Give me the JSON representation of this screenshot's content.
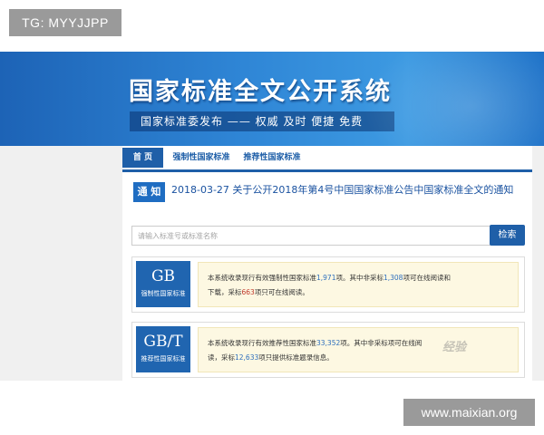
{
  "watermark": {
    "tag": "TG: MYYJJPP",
    "site": "www.maixian.org",
    "jingyan": "经验"
  },
  "banner": {
    "title": "国家标准全文公开系统",
    "slogan": "国家标准委发布 —— 权威 及时 便捷 免费"
  },
  "nav": {
    "tabs": [
      {
        "label": "首 页"
      },
      {
        "label": "强制性国家标准"
      },
      {
        "label": "推荐性国家标准"
      }
    ]
  },
  "notice": {
    "badge": "通 知",
    "text": "2018-03-27  关于公开2018年第4号中国国家标准公告中国家标准全文的通知"
  },
  "search": {
    "placeholder": "请输入标准号或标准名称",
    "button": "检索"
  },
  "standards": [
    {
      "code": "GB",
      "subtitle": "强制性国家标准",
      "line1_prefix": "本系统收录现行有效强制性国家标准",
      "total": "1,971",
      "line1_mid": "项。其中非采标",
      "non_adopted": "1,308",
      "line1_suffix": "项可在线阅读和",
      "line2_prefix": "下载，采标",
      "adopted": "663",
      "line2_suffix": "项只可在线阅读。"
    },
    {
      "code": "GB/T",
      "subtitle": "推荐性国家标准",
      "line1_prefix": "本系统收录现行有效推荐性国家标准",
      "total": "33,352",
      "line1_mid": "项。其中非采标",
      "non_adopted": "",
      "line1_suffix": "项可在线阅",
      "line2_prefix": "读，采标",
      "adopted": "12,633",
      "line2_suffix": "项只提供标准题录信息。"
    }
  ],
  "colors": {
    "accent": "#1f5fa8",
    "desc_bg": "#fdf8e2"
  }
}
